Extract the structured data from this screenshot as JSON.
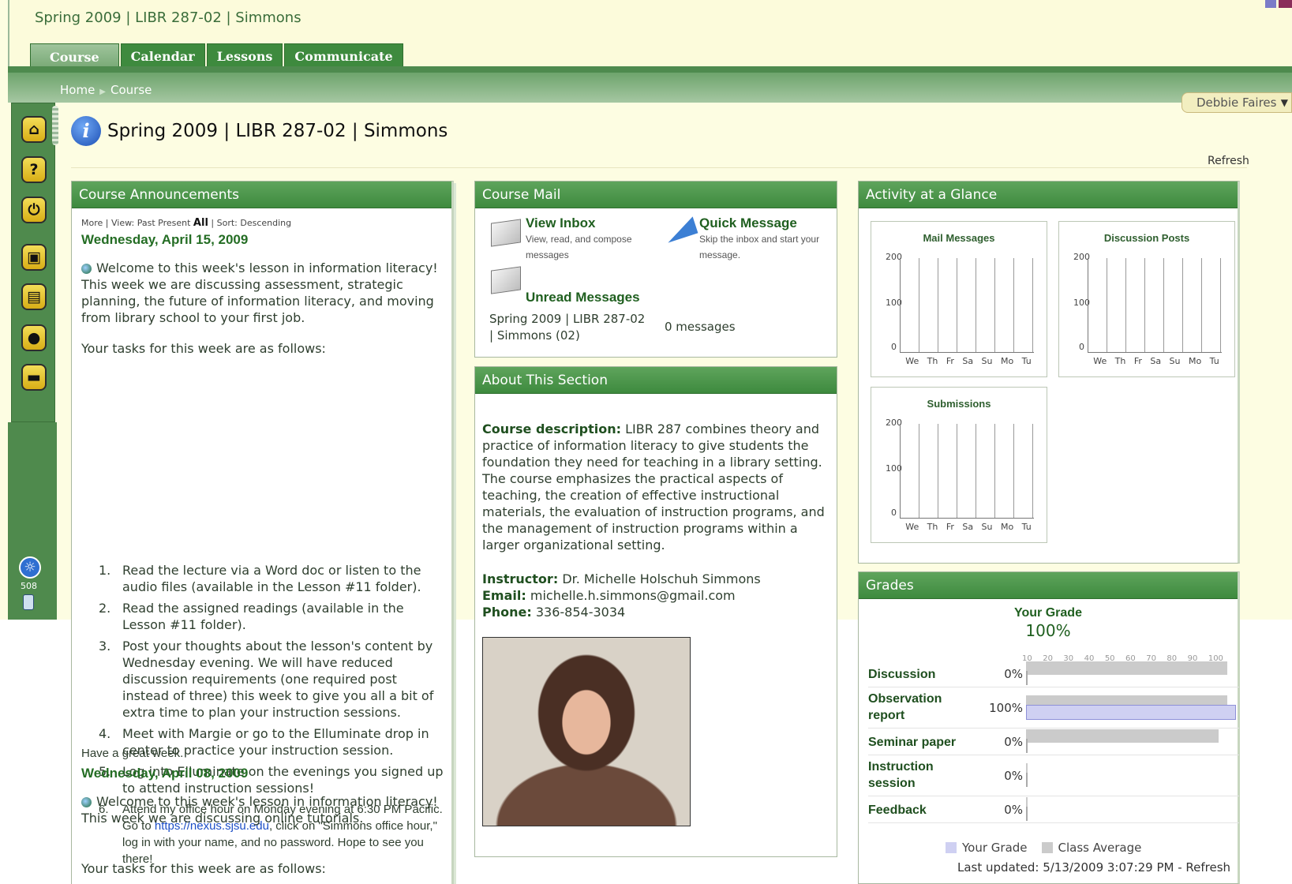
{
  "header": {
    "title": "Spring 2009 | LIBR 287-02 | Simmons",
    "tabs": [
      "Course",
      "Calendar",
      "Lessons",
      "Communicate"
    ]
  },
  "breadcrumb": {
    "home": "Home",
    "current": "Course"
  },
  "user": {
    "name": "Debbie Faires"
  },
  "sidebar": {
    "icons": [
      "home-icon",
      "help-icon",
      "power-icon",
      "briefcase-icon",
      "folder-icon",
      "person-icon",
      "chat-icon"
    ],
    "accessibility_number": "508"
  },
  "main": {
    "title": "Spring 2009 | LIBR 287-02 | Simmons",
    "refresh": "Refresh"
  },
  "announcements": {
    "title": "Course Announcements",
    "meta": {
      "more": "More",
      "view": "View:",
      "past": "Past",
      "present": "Present",
      "all": "All",
      "sort": "Sort: Descending"
    },
    "entries": [
      {
        "date": "Wednesday, April 15, 2009",
        "intro": "Welcome to this week's lesson in information literacy! This week we are discussing assessment, strategic planning, the future of information literacy, and moving from library school to your first job.",
        "tasks_intro": "Your tasks for this week are as follows:",
        "tasks": [
          "Read the lecture via a Word doc  or listen to the audio files (available in the Lesson #11 folder).",
          "Read the assigned readings (available in the Lesson #11 folder).",
          "Post your thoughts about the lesson's content by Wednesday evening.  We will have reduced discussion requirements (one required post instead of three) this week to give you all a bit of extra time to plan your instruction sessions.",
          "Meet with Margie or go to the Elluminate drop in center to practice your instruction session.",
          "Log into Elluminate on the evenings you signed up to attend instruction sessions!"
        ],
        "task6": {
          "pre": "Attend my office hour on Monday evening at 6:30 PM Pacific. Go to ",
          "link": "https://nexus.sjsu.edu",
          "post": ", click on \"Simmons office hour,\" log in with your name, and no password. Hope to see you there!"
        },
        "closing": "Have a great week."
      },
      {
        "date": "Wednesday, April 08, 2009",
        "intro": "Welcome to this week's lesson in information literacy! This week we are discussing online tutorials.",
        "tasks_intro": "Your tasks for this week are as follows:"
      }
    ]
  },
  "mail": {
    "title": "Course Mail",
    "view_inbox": {
      "title": "View Inbox",
      "desc": "View, read, and compose messages"
    },
    "quick": {
      "title": "Quick Message",
      "desc": "Skip the inbox and start your message."
    },
    "unread": {
      "title": "Unread Messages",
      "course": "Spring 2009 | LIBR 287-02 | Simmons (02)",
      "count": "0 messages"
    }
  },
  "about": {
    "title": "About This Section",
    "desc_label": "Course description:",
    "desc": "LIBR 287 combines theory and practice of information literacy to give students the foundation they need for teaching in a library setting. The course emphasizes the practical aspects of teaching, the creation of effective instructional materials, the evaluation of instruction programs, and the management of instruction programs within a larger organizational setting.",
    "instructor_label": "Instructor:",
    "instructor": "Dr. Michelle Holschuh Simmons",
    "email_label": "Email:",
    "email": "michelle.h.simmons@gmail.com",
    "phone_label": "Phone:",
    "phone": "336-854-3034"
  },
  "activity": {
    "title": "Activity at a Glance",
    "chart_data": [
      {
        "type": "bar",
        "title": "Mail Messages",
        "categories": [
          "We",
          "Th",
          "Fr",
          "Sa",
          "Su",
          "Mo",
          "Tu"
        ],
        "values": [
          0,
          0,
          0,
          0,
          0,
          0,
          0
        ],
        "yticks": [
          "200",
          "100",
          "0"
        ],
        "ylim": [
          0,
          200
        ]
      },
      {
        "type": "bar",
        "title": "Discussion Posts",
        "categories": [
          "We",
          "Th",
          "Fr",
          "Sa",
          "Su",
          "Mo",
          "Tu"
        ],
        "values": [
          0,
          0,
          0,
          0,
          0,
          0,
          0
        ],
        "yticks": [
          "200",
          "100",
          "0"
        ],
        "ylim": [
          0,
          200
        ]
      },
      {
        "type": "bar",
        "title": "Submissions",
        "categories": [
          "We",
          "Th",
          "Fr",
          "Sa",
          "Su",
          "Mo",
          "Tu"
        ],
        "values": [
          0,
          0,
          0,
          0,
          0,
          0,
          0
        ],
        "yticks": [
          "200",
          "100",
          "0"
        ],
        "ylim": [
          0,
          200
        ]
      }
    ]
  },
  "grades": {
    "title": "Grades",
    "your_grade_label": "Your Grade",
    "your_grade": "100%",
    "scale": [
      "10",
      "20",
      "30",
      "40",
      "50",
      "60",
      "70",
      "80",
      "90",
      "100"
    ],
    "chart_data": {
      "type": "bar",
      "categories": [
        "Discussion",
        "Observation report",
        "Seminar paper",
        "Instruction session",
        "Feedback"
      ],
      "series": [
        {
          "name": "Your Grade",
          "values": [
            0,
            100,
            0,
            0,
            0
          ]
        },
        {
          "name": "Class Average",
          "values": [
            98,
            98,
            94,
            0,
            0
          ]
        }
      ],
      "xlim": [
        0,
        100
      ]
    },
    "rows": [
      {
        "name": "Discussion",
        "pct": "0%"
      },
      {
        "name": "Observation report",
        "pct": "100%"
      },
      {
        "name": "Seminar paper",
        "pct": "0%"
      },
      {
        "name": "Instruction session",
        "pct": "0%"
      },
      {
        "name": "Feedback",
        "pct": "0%"
      }
    ],
    "legend": {
      "yours": "Your Grade",
      "average": "Class Average"
    },
    "updated": "Last updated: 5/13/2009 3:07:29 PM - Refresh",
    "colors": {
      "yours": "#cfd0f2",
      "average": "#cbcbcb"
    }
  }
}
